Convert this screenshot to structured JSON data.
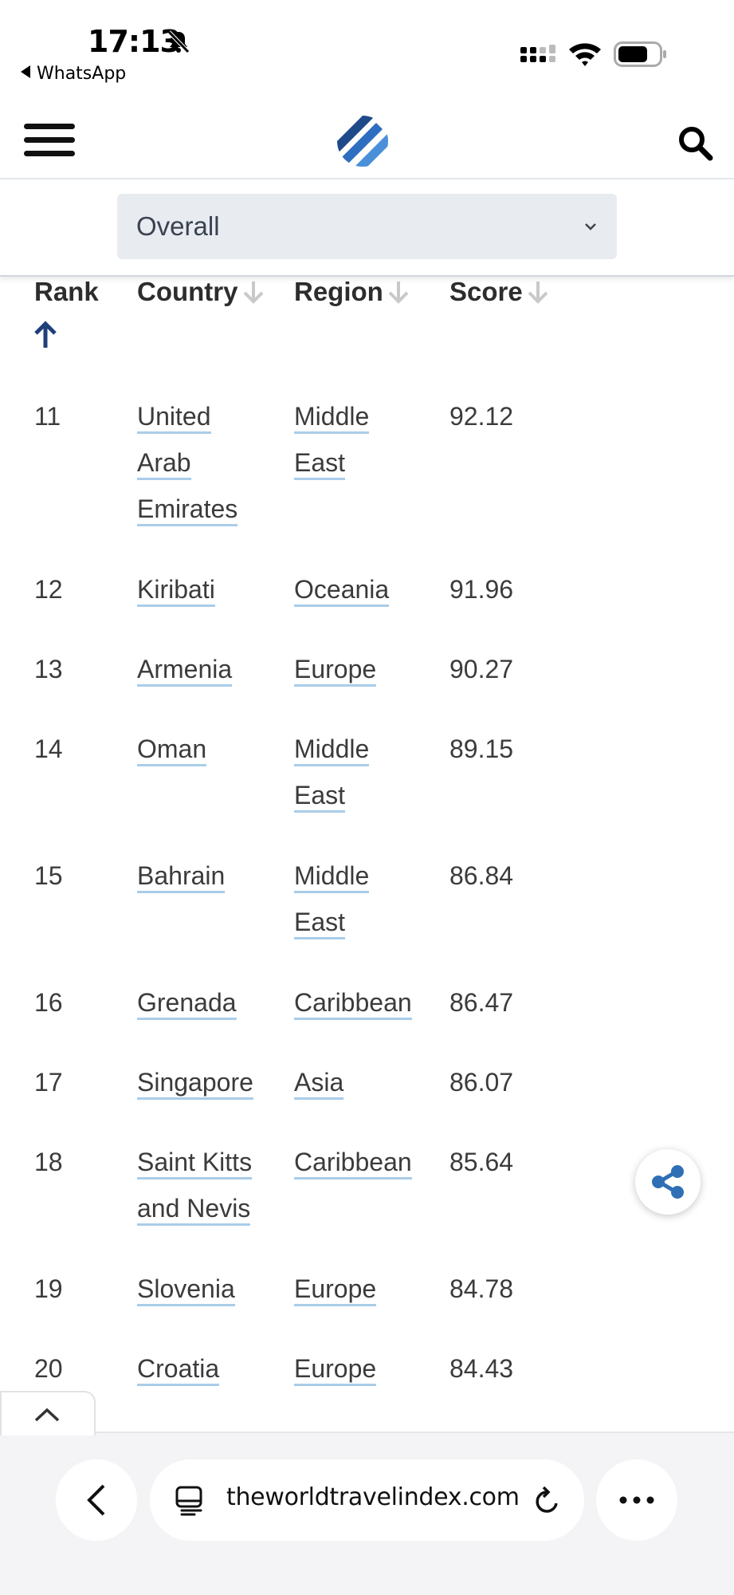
{
  "status_bar": {
    "time": "17:13",
    "back_app": "WhatsApp"
  },
  "header": {
    "menu_icon": "hamburger-icon",
    "logo_icon": "striped-globe-logo",
    "search_icon": "search-icon"
  },
  "filter": {
    "selected": "Overall"
  },
  "table": {
    "columns": {
      "rank": "Rank",
      "country": "Country",
      "region": "Region",
      "score": "Score"
    },
    "rows": [
      {
        "rank": "11",
        "country": "United Arab Emirates",
        "region": "Middle East",
        "score": "92.12"
      },
      {
        "rank": "12",
        "country": "Kiribati",
        "region": "Oceania",
        "score": "91.96"
      },
      {
        "rank": "13",
        "country": "Armenia",
        "region": "Europe",
        "score": "90.27"
      },
      {
        "rank": "14",
        "country": "Oman",
        "region": "Middle East",
        "score": "89.15"
      },
      {
        "rank": "15",
        "country": "Bahrain",
        "region": "Middle East",
        "score": "86.84"
      },
      {
        "rank": "16",
        "country": "Grenada",
        "region": "Caribbean",
        "score": "86.47"
      },
      {
        "rank": "17",
        "country": "Singapore",
        "region": "Asia",
        "score": "86.07"
      },
      {
        "rank": "18",
        "country": "Saint Kitts and Nevis",
        "region": "Caribbean",
        "score": "85.64"
      },
      {
        "rank": "19",
        "country": "Slovenia",
        "region": "Europe",
        "score": "84.78"
      },
      {
        "rank": "20",
        "country": "Croatia",
        "region": "Europe",
        "score": "84.43"
      }
    ]
  },
  "browser": {
    "url": "theworldtravelindex.com"
  },
  "colors": {
    "link_underline": "#a9cde9",
    "accent_blue": "#2f6fb5",
    "sort_active": "#1f3f7a"
  }
}
